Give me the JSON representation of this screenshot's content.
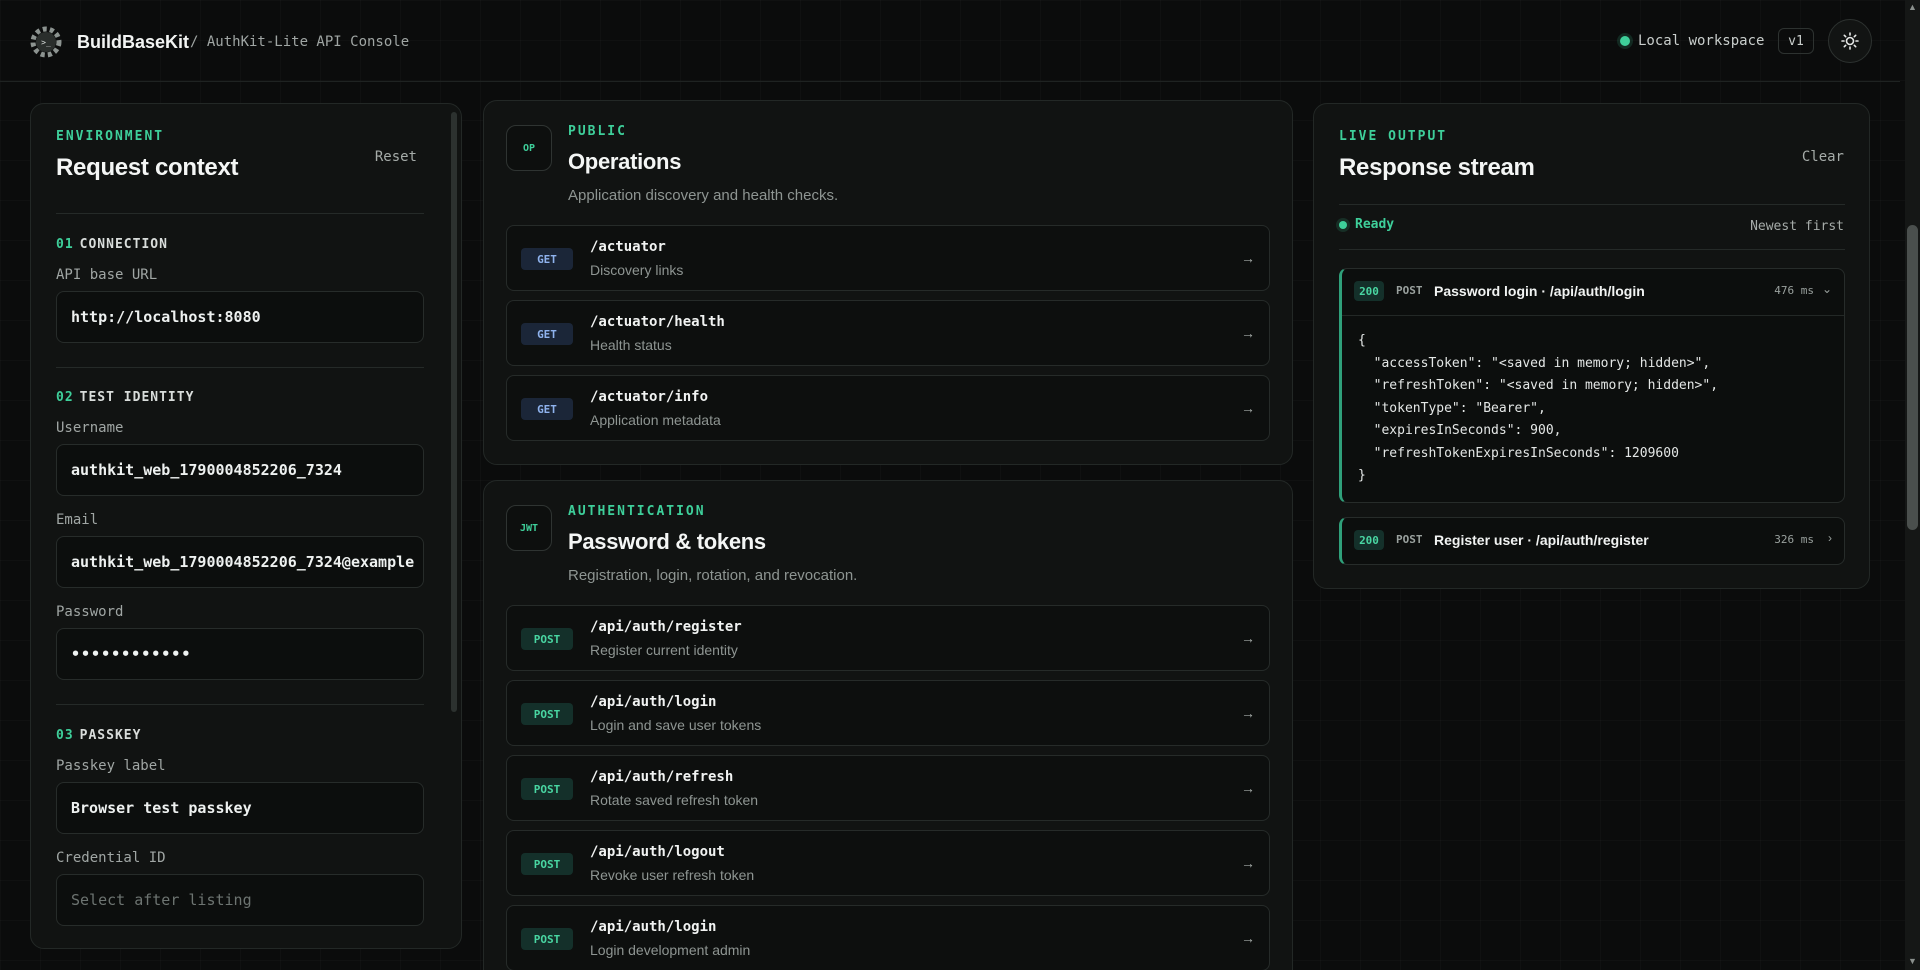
{
  "header": {
    "brand": "BuildBaseKit",
    "crumb": "/ AuthKit-Lite API Console",
    "workspace": "Local workspace",
    "version": "v1",
    "logo_icon": "gear-terminal-icon",
    "theme_icon": "sun-icon"
  },
  "left": {
    "kicker": "ENVIRONMENT",
    "title": "Request context",
    "reset": "Reset",
    "connection": {
      "num": "01",
      "label": "CONNECTION",
      "api_label": "API base URL",
      "api_value": "http://localhost:8080"
    },
    "identity": {
      "num": "02",
      "label": "TEST IDENTITY",
      "username_label": "Username",
      "username": "authkit_web_1790004852206_7324",
      "email_label": "Email",
      "email": "authkit_web_1790004852206_7324@example",
      "password_label": "Password",
      "password": "••••••••••••"
    },
    "passkey": {
      "num": "03",
      "label": "PASSKEY",
      "label_label": "Passkey label",
      "label_value": "Browser test passkey",
      "cred_label": "Credential ID",
      "cred_placeholder": "Select after listing"
    }
  },
  "ops": {
    "icon": "OP",
    "kicker": "PUBLIC",
    "title": "Operations",
    "subtitle": "Application discovery and health checks.",
    "rows": [
      {
        "method": "GET",
        "path": "/actuator",
        "desc": "Discovery links"
      },
      {
        "method": "GET",
        "path": "/actuator/health",
        "desc": "Health status"
      },
      {
        "method": "GET",
        "path": "/actuator/info",
        "desc": "Application metadata"
      }
    ]
  },
  "auth": {
    "icon": "JWT",
    "kicker": "AUTHENTICATION",
    "title": "Password & tokens",
    "subtitle": "Registration, login, rotation, and revocation.",
    "rows": [
      {
        "method": "POST",
        "path": "/api/auth/register",
        "desc": "Register current identity"
      },
      {
        "method": "POST",
        "path": "/api/auth/login",
        "desc": "Login and save user tokens"
      },
      {
        "method": "POST",
        "path": "/api/auth/refresh",
        "desc": "Rotate saved refresh token"
      },
      {
        "method": "POST",
        "path": "/api/auth/logout",
        "desc": "Revoke user refresh token"
      },
      {
        "method": "POST",
        "path": "/api/auth/login",
        "desc": "Login development admin"
      }
    ]
  },
  "right": {
    "kicker": "LIVE OUTPUT",
    "title": "Response stream",
    "clear": "Clear",
    "status": "Ready",
    "order": "Newest first",
    "responses": [
      {
        "code": "200",
        "method": "POST",
        "title": "Password login · /api/auth/login",
        "ms": "476 ms",
        "body": "{\n  \"accessToken\": \"<saved in memory; hidden>\",\n  \"refreshToken\": \"<saved in memory; hidden>\",\n  \"tokenType\": \"Bearer\",\n  \"expiresInSeconds\": 900,\n  \"refreshTokenExpiresInSeconds\": 1209600\n}"
      },
      {
        "code": "200",
        "method": "POST",
        "title": "Register user · /api/auth/register",
        "ms": "326 ms"
      }
    ]
  }
}
